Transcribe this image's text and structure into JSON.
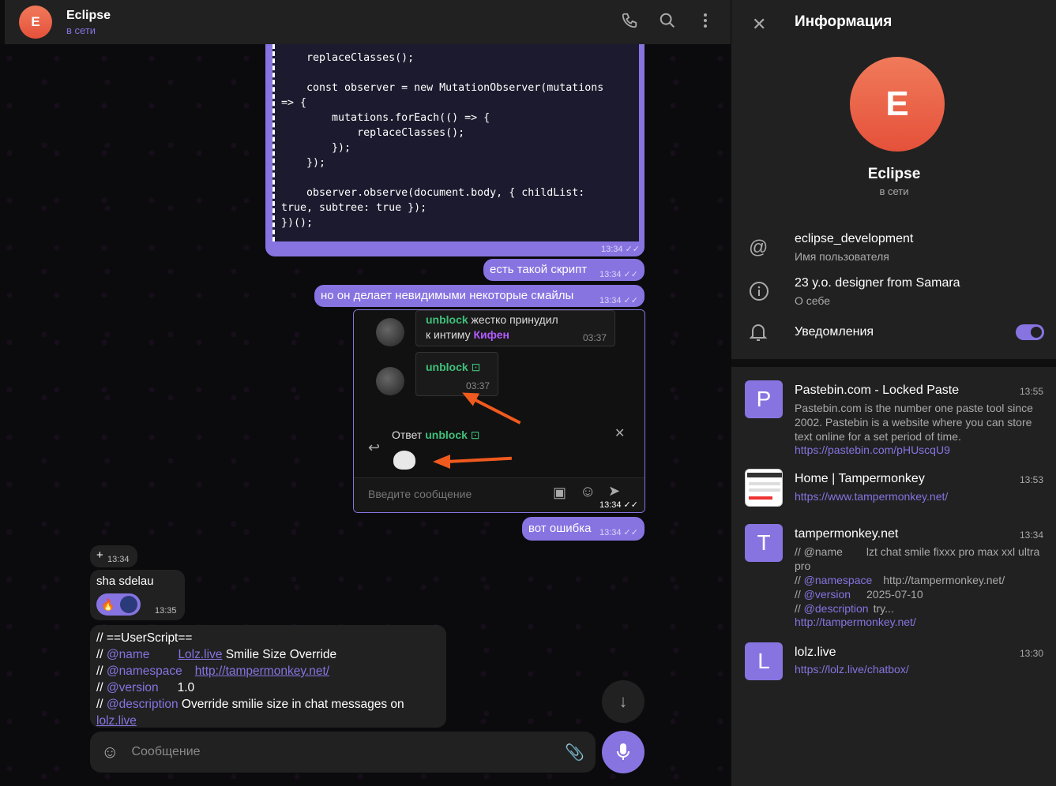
{
  "header": {
    "avatar_letter": "E",
    "name": "Eclipse",
    "status": "в сети"
  },
  "code_block": {
    "text": "    replaceClasses();\n\n    const observer = new MutationObserver(mutations\n=> {\n        mutations.forEach(() => {\n            replaceClasses();\n        });\n    });\n\n    observer.observe(document.body, { childList:\ntrue, subtree: true });\n})();",
    "time": "13:34"
  },
  "messages": {
    "m1": {
      "text": "есть такой скрипт",
      "time": "13:34"
    },
    "m2": {
      "text": "но он делает невидимыми некоторые смайлы",
      "time": "13:34"
    },
    "m3": {
      "text": "вот ошибка",
      "time": "13:34"
    },
    "screenshot_time": "13:34"
  },
  "screenshot": {
    "msg1_name": "unblock",
    "msg1_text_a": " жестко принудил",
    "msg1_text_b": "к интиму ",
    "msg1_mention": "Кифен",
    "msg1_time": "03:37",
    "msg2_name": "unblock",
    "msg2_time": "03:37",
    "reply_label": "Ответ ",
    "reply_name": "unblock",
    "input_placeholder": "Введите сообщение"
  },
  "incoming": {
    "plus_time": "13:34",
    "text": "sha sdelau",
    "time": "13:35"
  },
  "script_msg": {
    "line1": "// ==UserScript==",
    "l2_prefix": "// ",
    "l2_key": "@name",
    "l2_link": "Lolz.live",
    "l2_rest": " Smilie Size Override",
    "l3_prefix": "// ",
    "l3_key": "@namespace",
    "l3_link": "http://tampermonkey.net/",
    "l4_prefix": "// ",
    "l4_key": "@version",
    "l4_val": "1.0",
    "l5_prefix": "// ",
    "l5_key": "@description",
    "l5_val": " Override smilie size in chat messages on",
    "l6_link": "lolz.live"
  },
  "composer": {
    "placeholder": "Сообщение"
  },
  "panel": {
    "title": "Информация",
    "avatar_letter": "E",
    "name": "Eclipse",
    "status": "в сети",
    "username": "eclipse_development",
    "username_label": "Имя пользователя",
    "bio": "23 y.o. designer from Samara",
    "bio_label": "О себе",
    "notifications_label": "Уведомления",
    "notifications_on": true
  },
  "links": [
    {
      "thumb": "P",
      "title": "Pastebin.com - Locked Paste",
      "time": "13:55",
      "desc": "Pastebin.com is the number one paste tool since 2002. Pastebin is a website where you can store text online for a set period of time.",
      "url": "https://pastebin.com/pHUscqU9"
    },
    {
      "thumb": "",
      "title": "Home | Tampermonkey",
      "time": "13:53",
      "desc": "",
      "url": "https://www.tampermonkey.net/"
    },
    {
      "thumb": "T",
      "title": "tampermonkey.net",
      "time": "13:34",
      "d1_prefix": "// @name",
      "d1_val": "lzt chat smile fixxx pro max xxl ultra pro",
      "d2_key": "@namespace",
      "d2_val": "http://tampermonkey.net/",
      "d3_key": "@version",
      "d3_val": "2025-07-10",
      "d4_key": "@description",
      "d4_val": "try...",
      "url": "http://tampermonkey.net/"
    },
    {
      "thumb": "L",
      "title": "lolz.live",
      "time": "13:30",
      "url": "https://lolz.live/chatbox/"
    }
  ],
  "colors": {
    "accent": "#8774e1",
    "avatar": "#e5513a",
    "panel_bg": "#212121",
    "arrow": "#f05a1e"
  }
}
